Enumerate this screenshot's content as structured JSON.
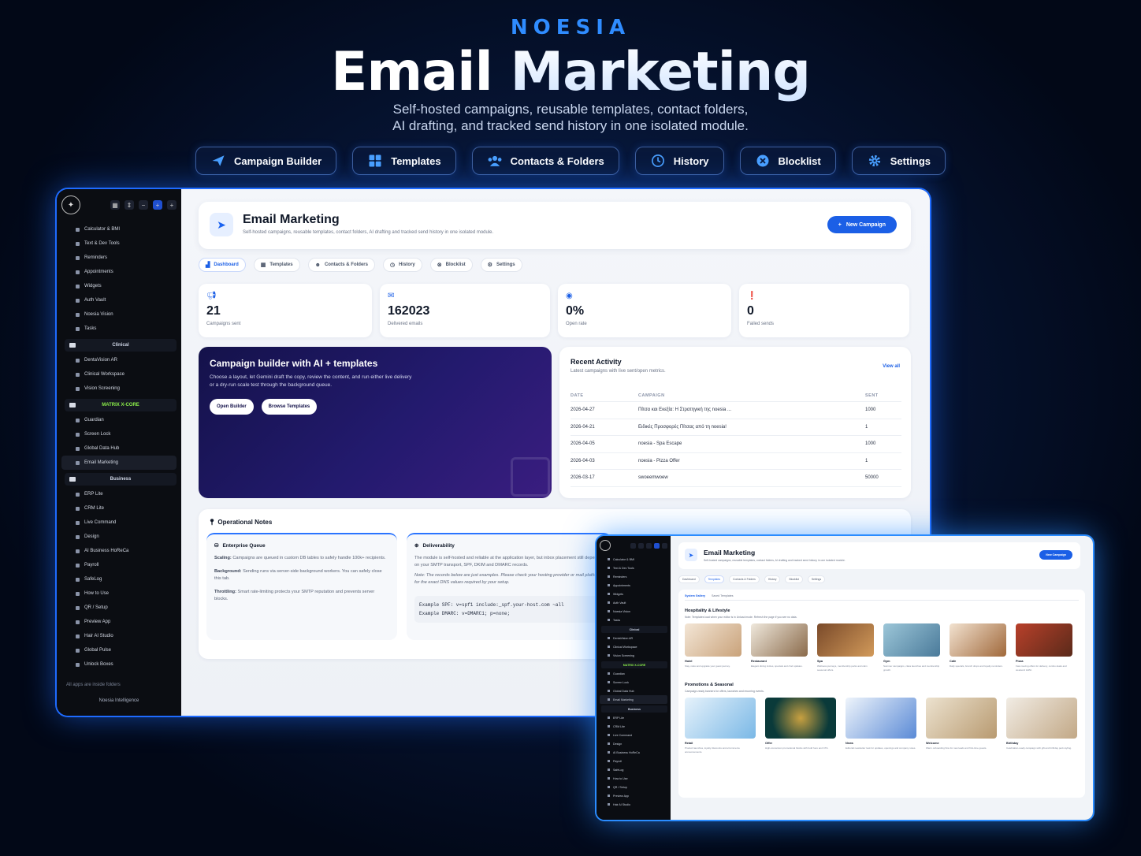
{
  "hero": {
    "brand": "NOESIA",
    "title_1": "Email",
    "title_2": "Marketing",
    "subtitle_1": "Self-hosted campaigns, reusable templates, contact folders,",
    "subtitle_2": "AI drafting, and tracked send history in one isolated module."
  },
  "pills": [
    {
      "label": "Campaign Builder",
      "icon": "send-icon"
    },
    {
      "label": "Templates",
      "icon": "grid-icon"
    },
    {
      "label": "Contacts & Folders",
      "icon": "users-icon"
    },
    {
      "label": "History",
      "icon": "clock-icon"
    },
    {
      "label": "Blocklist",
      "icon": "x-circle-icon"
    },
    {
      "label": "Settings",
      "icon": "gear-icon"
    }
  ],
  "sidebar": {
    "items_a": [
      "Calculator & BMI",
      "Text & Dev Tools",
      "Reminders",
      "Appointments",
      "Widgets",
      "Auth Vault",
      "Noesia Vision",
      "Tasks"
    ],
    "group_clinical": "Clinical",
    "items_clinical": [
      "DentaVision AR",
      "Clinical Workspace",
      "Vision Screening"
    ],
    "group_matrix": "MATRIX X-CORE",
    "items_matrix": [
      "Guardian",
      "Screen Lock",
      "Global Data Hub",
      "Email Marketing"
    ],
    "group_business": "Business",
    "items_business": [
      "ERP Lite",
      "CRM Lite",
      "Live Command",
      "Design",
      "AI Business HoReCa",
      "Payroll",
      "SafeLog",
      "How to Use",
      "QR / Setup",
      "Preview App",
      "Hair AI Studio",
      "Global Pulse",
      "Unlock Boxes"
    ],
    "footer_note": "All apps are inside folders",
    "footer_brand": "Noesia Intelligence"
  },
  "header": {
    "title": "Email Marketing",
    "subtitle": "Self-hosted campaigns, reusable templates, contact folders, AI drafting and tracked send history in one isolated module.",
    "new_campaign": "New Campaign"
  },
  "tabs": [
    "Dashboard",
    "Templates",
    "Contacts & Folders",
    "History",
    "Blocklist",
    "Settings"
  ],
  "stats": [
    {
      "value": "21",
      "label": "Campaigns sent",
      "icon": "megaphone-icon"
    },
    {
      "value": "162023",
      "label": "Delivered emails",
      "icon": "mail-icon"
    },
    {
      "value": "0%",
      "label": "Open rate",
      "icon": "eye-icon"
    },
    {
      "value": "0",
      "label": "Failed sends",
      "icon": "alert-icon"
    }
  ],
  "promo": {
    "title": "Campaign builder with AI + templates",
    "desc": "Choose a layout, let Gemini draft the copy, review the content, and run either live delivery or a dry-run scale test through the background queue.",
    "btn_open": "Open Builder",
    "btn_browse": "Browse Templates"
  },
  "recent": {
    "title": "Recent Activity",
    "subtitle": "Latest campaigns with live sent/open metrics.",
    "view_all": "View all",
    "headers": [
      "DATE",
      "CAMPAIGN",
      "SENT"
    ],
    "rows": [
      [
        "2026-04-27",
        "Πίτσα και Εκεξία: Η Στρατηγική της noesia ...",
        "1000"
      ],
      [
        "2026-04-21",
        "Ειδικές Προσφορές Πίτσας από τη noesia!",
        "1"
      ],
      [
        "2026-04-05",
        "noesia - Spa Escape",
        "1000"
      ],
      [
        "2026-04-03",
        "noesia - Pizza Offer",
        "1"
      ],
      [
        "2026-03-17",
        "swoeemwoew",
        "50000"
      ]
    ]
  },
  "ops": {
    "title": "Operational Notes",
    "card1_title": "Enterprise Queue",
    "card1_p1_b": "Scaling:",
    "card1_p1": "Campaigns are queued in custom DB tables to safely handle 100k+ recipients.",
    "card1_p2_b": "Background:",
    "card1_p2": "Sending runs via server-side background workers. You can safely close this tab.",
    "card1_p3_b": "Throttling:",
    "card1_p3": "Smart rate-limiting protects your SMTP reputation and prevents server blocks.",
    "card2_title": "Deliverability",
    "card2_p1": "The module is self-hosted and reliable at the application layer, but inbox placement still depends on your SMTP transport, SPF, DKIM and DMARC records.",
    "card2_p2": "Note: The records below are just examples. Please check your hosting provider or mail platform for the exact DNS values required by your setup.",
    "card2_code1": "Example SPF:  v=spf1 include:_spf.your-host.com ~all",
    "card2_code2": "Example DMARC:  v=DMARC1; p=none;"
  },
  "win2": {
    "title": "Email Marketing",
    "subtitle": "Self-hosted campaigns, reusable templates, contact folders, AI drafting and tracked send history in one isolated module.",
    "btn": "New Campaign",
    "tabs": [
      "Dashboard",
      "Templates",
      "Contacts & Folders",
      "History",
      "Blocklist",
      "Settings"
    ],
    "subtabs": [
      "System Gallery",
      "Saved Templates"
    ],
    "section1": "Hospitality & Lifestyle",
    "section1_desc": "Note: Templates load when your editor is in Unload mode. Refresh the page if you see no data.",
    "tpl1": [
      {
        "name": "Hotel",
        "desc": "Stay, relax and upgrade your guest journey."
      },
      {
        "name": "Restaurant",
        "desc": "Elegant dining invites, specials and chef updates."
      },
      {
        "name": "Spa",
        "desc": "Wellness journeys, membership perks and calm seasonal offers."
      },
      {
        "name": "Gym",
        "desc": "Summer campaigns, class launches and membership growth."
      },
      {
        "name": "Cafe",
        "desc": "Daily specials, brunch drops and loyalty reminders."
      },
      {
        "name": "Pizza",
        "desc": "Fast-moving offers for delivery, combo deals and weekend traffic."
      }
    ],
    "section2": "Promotions & Seasonal",
    "section2_desc": "Campaign-ready banners for offers, launches and recurring events.",
    "tpl2": [
      {
        "name": "Retail",
        "desc": "Product launches, loyalty discounts and eCommerce announcements."
      },
      {
        "name": "Offer",
        "desc": "High-conversion promotional blocks with bold hero and CTA."
      },
      {
        "name": "News",
        "desc": "Editorial newsletter look for updates, openings and company notes."
      },
      {
        "name": "Welcome",
        "desc": "Warm onboarding flow for new leads and first-time guests."
      },
      {
        "name": "Birthday",
        "desc": "Celebration-ready campaign with gift and birthday perk styling."
      }
    ]
  },
  "colors": {
    "accent": "#1b5fe6",
    "brand": "#2f8cff",
    "glow": "#1e6bff"
  }
}
